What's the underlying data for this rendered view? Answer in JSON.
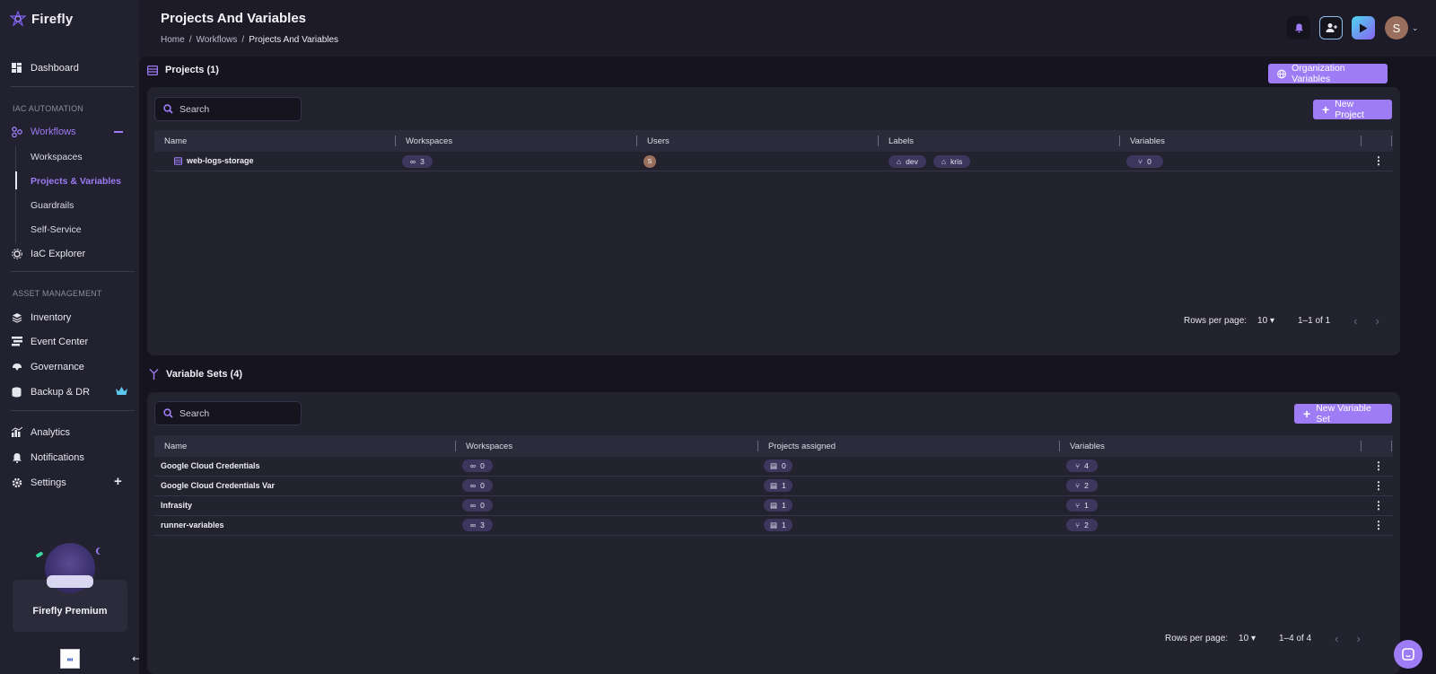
{
  "app": {
    "name": "Firefly"
  },
  "header": {
    "title": "Projects And Variables",
    "breadcrumb": [
      "Home",
      "/",
      "Workflows",
      "/",
      "Projects And Variables"
    ],
    "user_initial": "S"
  },
  "sidebar": {
    "dashboard": "Dashboard",
    "iac_section": "IAC AUTOMATION",
    "workflows": "Workflows",
    "workflows_sub": [
      "Workspaces",
      "Projects & Variables",
      "Guardrails",
      "Self-Service"
    ],
    "iac_explorer": "IaC Explorer",
    "asset_section": "ASSET MANAGEMENT",
    "inventory": "Inventory",
    "event_center": "Event Center",
    "governance": "Governance",
    "backup": "Backup & DR",
    "analytics": "Analytics",
    "notifications": "Notifications",
    "settings": "Settings",
    "premium": "Firefly Premium"
  },
  "projects": {
    "title": "Projects (1)",
    "org_vars_button": "Organization Variables",
    "search_placeholder": "Search",
    "new_button": "New Project",
    "columns": [
      "Name",
      "Workspaces",
      "Users",
      "Labels",
      "Variables"
    ],
    "rows": [
      {
        "name": "web-logs-storage",
        "workspaces": "3",
        "user": "S",
        "labels": [
          "dev",
          "kris"
        ],
        "variables": "0"
      }
    ],
    "pager": {
      "rows_label": "Rows per page:",
      "rows_value": "10",
      "range": "1–1 of 1"
    }
  },
  "variable_sets": {
    "title": "Variable Sets (4)",
    "search_placeholder": "Search",
    "new_button": "New Variable Set",
    "columns": [
      "Name",
      "Workspaces",
      "Projects assigned",
      "Variables"
    ],
    "rows": [
      {
        "name": "Google Cloud Credentials",
        "workspaces": "0",
        "projects": "0",
        "variables": "4"
      },
      {
        "name": "Google Cloud Credentials Var",
        "workspaces": "0",
        "projects": "1",
        "variables": "2"
      },
      {
        "name": "Infrasity",
        "workspaces": "0",
        "projects": "1",
        "variables": "1"
      },
      {
        "name": "runner-variables",
        "workspaces": "3",
        "projects": "1",
        "variables": "2"
      }
    ],
    "pager": {
      "rows_label": "Rows per page:",
      "rows_value": "10",
      "range": "1–4 of 4"
    }
  },
  "colors": {
    "accent": "#9d7cf5",
    "background": "#16151f",
    "panel": "#23222f",
    "sidebar": "#22212f"
  },
  "icons": [
    "firefly-logo-icon",
    "dashboard-icon",
    "workflows-icon",
    "iac-explorer-icon",
    "inventory-icon",
    "event-center-icon",
    "governance-icon",
    "backup-icon",
    "crown-icon",
    "analytics-icon",
    "notifications-icon",
    "settings-icon",
    "bell-icon",
    "add-user-icon",
    "play-icon",
    "search-icon",
    "plus-icon",
    "globe-icon",
    "link-icon",
    "tag-icon",
    "variable-icon",
    "project-icon",
    "kebab-icon",
    "chevron-left-icon",
    "chevron-right-icon",
    "chat-icon"
  ]
}
